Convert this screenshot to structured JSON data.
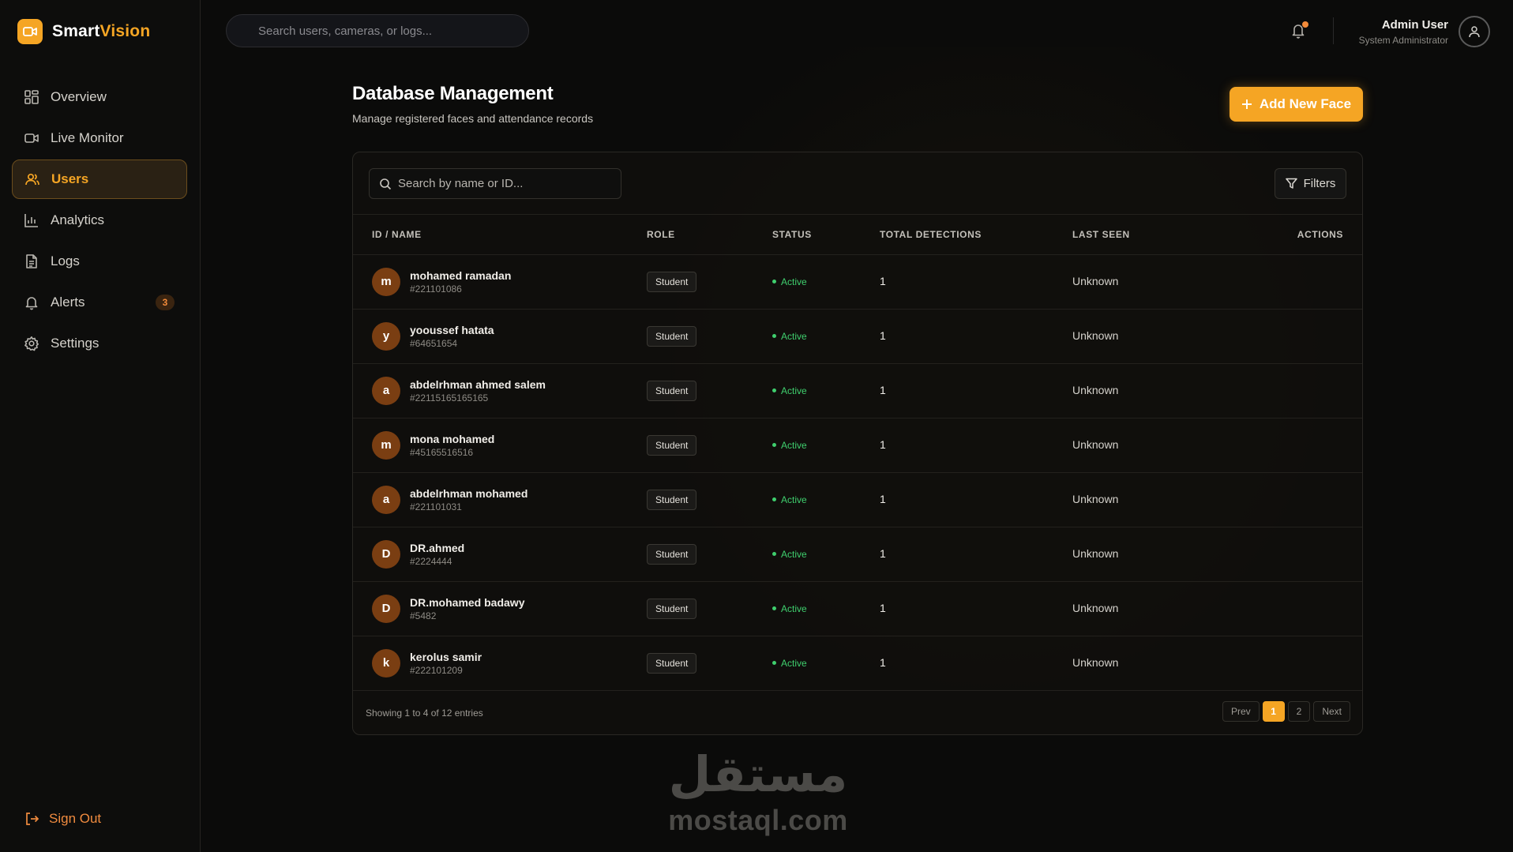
{
  "brand": {
    "name_part1": "Smart",
    "name_part2": "Vision",
    "accent_color": "#f5a524",
    "icon": "camera-icon"
  },
  "sidebar": {
    "items": [
      {
        "label": "Overview",
        "icon": "grid-icon"
      },
      {
        "label": "Live Monitor",
        "icon": "video-icon"
      },
      {
        "label": "Users",
        "icon": "users-icon",
        "active": true
      },
      {
        "label": "Analytics",
        "icon": "bar-chart-icon"
      },
      {
        "label": "Logs",
        "icon": "document-icon"
      },
      {
        "label": "Alerts",
        "icon": "bell-icon",
        "badge": "3"
      },
      {
        "label": "Settings",
        "icon": "gear-icon"
      }
    ],
    "sign_out": "Sign Out"
  },
  "header": {
    "search_placeholder": "Search users, cameras, or logs...",
    "user_name": "Admin User",
    "user_role": "System Administrator"
  },
  "page": {
    "title": "Database Management",
    "subtitle": "Manage registered faces and attendance records",
    "add_button": "Add New Face"
  },
  "table": {
    "search_placeholder": "Search by name or ID...",
    "filters_label": "Filters",
    "columns": [
      "ID / NAME",
      "ROLE",
      "STATUS",
      "TOTAL DETECTIONS",
      "LAST SEEN",
      "ACTIONS"
    ],
    "rows": [
      {
        "initial": "m",
        "name": "mohamed ramadan",
        "id": "#221101086",
        "role": "Student",
        "status": "Active",
        "detections": "1",
        "last_seen": "Unknown"
      },
      {
        "initial": "y",
        "name": "yooussef hatata",
        "id": "#64651654",
        "role": "Student",
        "status": "Active",
        "detections": "1",
        "last_seen": "Unknown"
      },
      {
        "initial": "a",
        "name": "abdelrhman ahmed salem",
        "id": "#22115165165165",
        "role": "Student",
        "status": "Active",
        "detections": "1",
        "last_seen": "Unknown"
      },
      {
        "initial": "m",
        "name": "mona mohamed",
        "id": "#45165516516",
        "role": "Student",
        "status": "Active",
        "detections": "1",
        "last_seen": "Unknown"
      },
      {
        "initial": "a",
        "name": "abdelrhman mohamed",
        "id": "#221101031",
        "role": "Student",
        "status": "Active",
        "detections": "1",
        "last_seen": "Unknown"
      },
      {
        "initial": "D",
        "name": "DR.ahmed",
        "id": "#2224444",
        "role": "Student",
        "status": "Active",
        "detections": "1",
        "last_seen": "Unknown"
      },
      {
        "initial": "D",
        "name": "DR.mohamed badawy",
        "id": "#5482",
        "role": "Student",
        "status": "Active",
        "detections": "1",
        "last_seen": "Unknown"
      },
      {
        "initial": "k",
        "name": "kerolus samir",
        "id": "#222101209",
        "role": "Student",
        "status": "Active",
        "detections": "1",
        "last_seen": "Unknown"
      }
    ],
    "showing_text": "Showing 1 to 4 of 12 entries",
    "pagination": {
      "prev": "Prev",
      "pages": [
        "1",
        "2"
      ],
      "current": "1",
      "next": "Next"
    }
  },
  "watermark": {
    "arabic": "مستقل",
    "latin": "mostaql.com"
  }
}
